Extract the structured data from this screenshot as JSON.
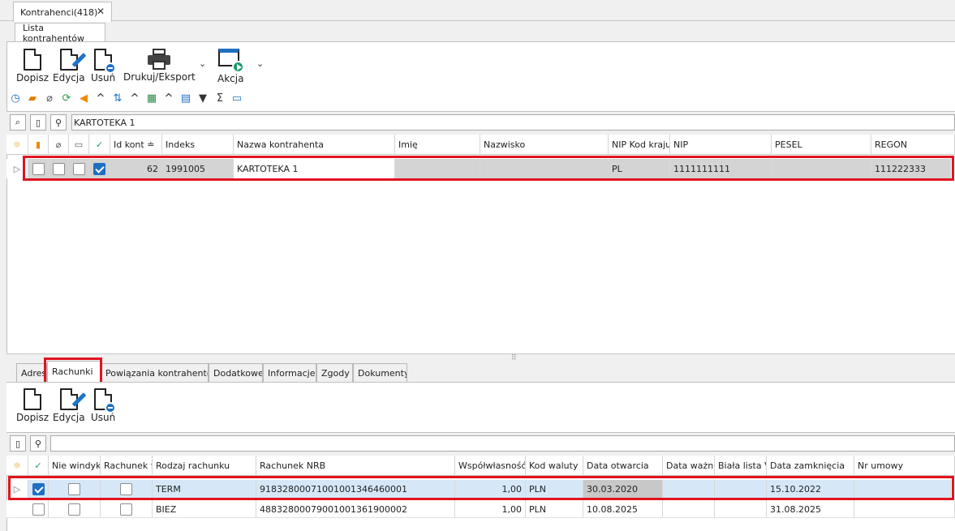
{
  "doc_tab": {
    "label": "Kontrahenci(418)",
    "close": "✕"
  },
  "sub_tab": {
    "label": "Lista kontrahentów"
  },
  "toolbar": {
    "dopisz": "Dopisz",
    "edycja": "Edycja",
    "usun": "Usuń",
    "drukuj": "Drukuj/Eksport",
    "akcja": "Akcja",
    "caret": "⌄"
  },
  "small_toolbar": {
    "up": "^"
  },
  "search": {
    "value": "KARTOTEKA 1"
  },
  "top_grid": {
    "headers": [
      "Id kont",
      "Indeks",
      "Nazwa kontrahenta",
      "Imię",
      "Nazwisko",
      "NIP Kod kraju",
      "NIP",
      "PESEL",
      "REGON"
    ],
    "sort_icon": "≐",
    "rows": [
      {
        "id": "62",
        "indeks": "1991005",
        "nazwa": "KARTOTEKA 1",
        "imie": "",
        "nazwisko": "",
        "kod_kraju": "PL",
        "nip": "1111111111",
        "pesel": "",
        "regon": "111222333"
      }
    ]
  },
  "bottom_tabs": [
    "Adres",
    "Rachunki",
    "Powiązania kontrahentów",
    "Dodatkowe",
    "Informacje",
    "Zgody",
    "Dokumenty"
  ],
  "bottom_toolbar": {
    "dopisz": "Dopisz",
    "edycja": "Edycja",
    "usun": "Usuń"
  },
  "bottom_grid": {
    "headers": [
      "Nie windyk",
      "Rachunek f",
      "Rodzaj rachunku",
      "Rachunek NRB",
      "Współwłasność",
      "Kod waluty",
      "Data otwarcia",
      "Data ważn",
      "Biała lista V",
      "Data zamknięcia",
      "Nr umowy"
    ],
    "rows": [
      {
        "checked": true,
        "rodzaj": "TERM",
        "nrb": "91832800071001001346460001",
        "wspol": "1,00",
        "waluta": "PLN",
        "otwarcia": "30.03.2020",
        "wazn": "",
        "biala": "",
        "zamkniecia": "15.10.2022",
        "umowa": ""
      },
      {
        "checked": false,
        "rodzaj": "BIEZ",
        "nrb": "48832800079001001361900002",
        "wspol": "1,00",
        "waluta": "PLN",
        "otwarcia": "10.08.2025",
        "wazn": "",
        "biala": "",
        "zamkniecia": "31.08.2025",
        "umowa": ""
      }
    ]
  },
  "colors": {
    "accent": "#1f6fc2",
    "highlight": "#e0141f",
    "selected_row": "#d6e8f8"
  }
}
